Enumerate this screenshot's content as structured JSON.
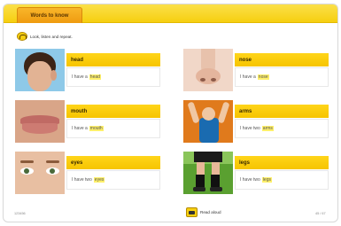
{
  "header": {
    "title": "Words to know"
  },
  "instruction": {
    "text": "Look, listen and repeat."
  },
  "cards": [
    {
      "word": "head",
      "prefix": "I have a",
      "highlight": "head"
    },
    {
      "word": "nose",
      "prefix": "I have a",
      "highlight": "nose"
    },
    {
      "word": "mouth",
      "prefix": "I have a",
      "highlight": "mouth"
    },
    {
      "word": "arms",
      "prefix": "I have two",
      "highlight": "arms"
    },
    {
      "word": "eyes",
      "prefix": "I have two",
      "highlight": "eyes"
    },
    {
      "word": "legs",
      "prefix": "I have two",
      "highlight": "legs"
    }
  ],
  "read_aloud": {
    "label": "Read aloud"
  },
  "footer": {
    "left": "123456",
    "right": "45 / 67"
  },
  "colors": {
    "accent": "#f6cf10",
    "tab": "#ef9b10",
    "highlight": "#fff06a"
  },
  "icons": {
    "listen": "listen-icon",
    "read_aloud": "read-aloud-icon"
  }
}
